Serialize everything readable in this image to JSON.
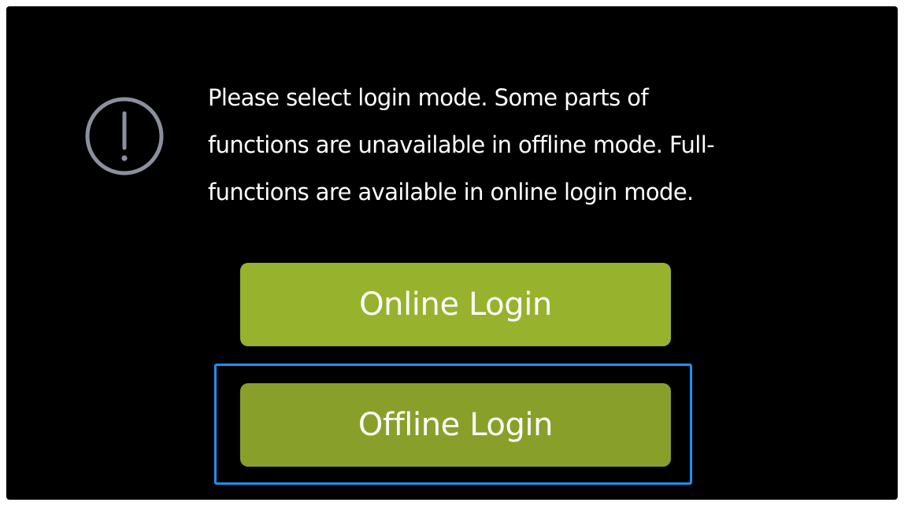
{
  "dialog": {
    "icon": "exclamation-circle-icon",
    "message": "Please select login mode. Some parts of\nfunctions are unavailable in offline mode. Full-\nfunctions are available in online login mode.",
    "buttons": {
      "online_label": "Online Login",
      "offline_label": "Offline Login"
    },
    "focused_button": "offline",
    "colors": {
      "background": "#000000",
      "online_button": "#97b22c",
      "offline_button": "#88a02a",
      "focus_ring": "#1f8ff2",
      "icon": "#8c8f9e",
      "text": "#ffffff"
    }
  }
}
